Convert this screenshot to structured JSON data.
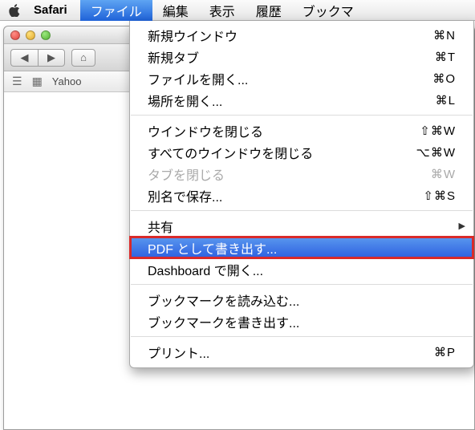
{
  "menubar": {
    "app": "Safari",
    "items": [
      "ファイル",
      "編集",
      "表示",
      "履歴",
      "ブックマ"
    ]
  },
  "browser": {
    "bookmark_item": "Yahoo"
  },
  "file_menu": {
    "new_window": {
      "label": "新規ウインドウ",
      "shortcut": "⌘N"
    },
    "new_tab": {
      "label": "新規タブ",
      "shortcut": "⌘T"
    },
    "open_file": {
      "label": "ファイルを開く...",
      "shortcut": "⌘O"
    },
    "open_location": {
      "label": "場所を開く...",
      "shortcut": "⌘L"
    },
    "close_window": {
      "label": "ウインドウを閉じる",
      "shortcut": "⇧⌘W"
    },
    "close_all_windows": {
      "label": "すべてのウインドウを閉じる",
      "shortcut": "⌥⌘W"
    },
    "close_tab": {
      "label": "タブを閉じる",
      "shortcut": "⌘W"
    },
    "save_as": {
      "label": "別名で保存...",
      "shortcut": "⇧⌘S"
    },
    "share": {
      "label": "共有",
      "shortcut": ""
    },
    "export_pdf": {
      "label": "PDF として書き出す...",
      "shortcut": ""
    },
    "open_dashboard": {
      "label": "Dashboard で開く...",
      "shortcut": ""
    },
    "import_bookmarks": {
      "label": "ブックマークを読み込む...",
      "shortcut": ""
    },
    "export_bookmarks": {
      "label": "ブックマークを書き出す...",
      "shortcut": ""
    },
    "print": {
      "label": "プリント...",
      "shortcut": "⌘P"
    }
  }
}
